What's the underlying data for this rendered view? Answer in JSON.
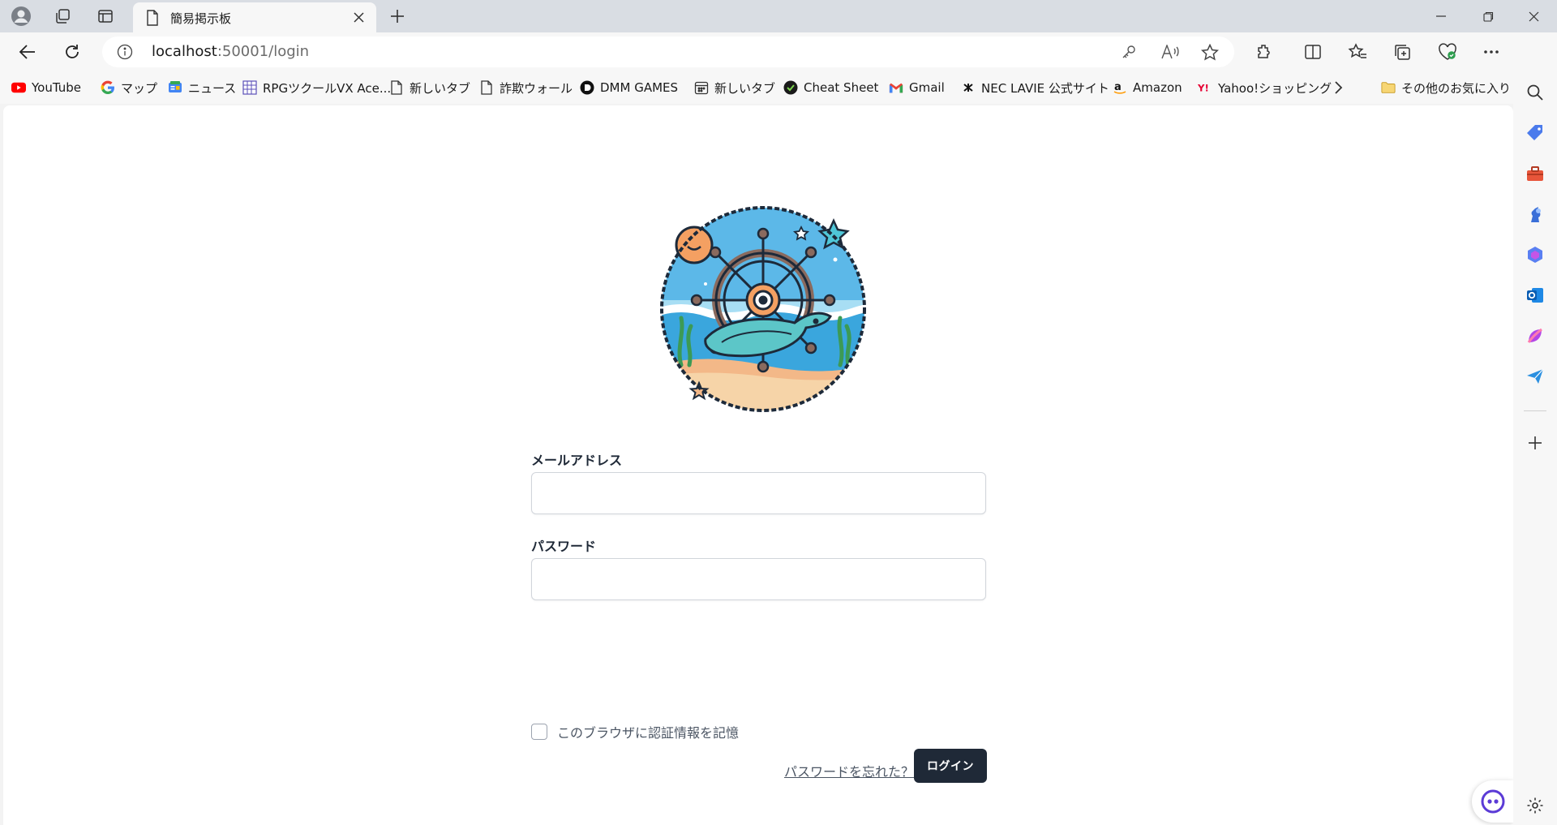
{
  "browser": {
    "tab": {
      "title": "簡易掲示板"
    },
    "address": {
      "host": "localhost",
      "path": ":50001/login"
    }
  },
  "bookmarks": [
    {
      "label": "YouTube",
      "icon": "youtube-icon"
    },
    {
      "label": "マップ",
      "icon": "google-icon"
    },
    {
      "label": "ニュース",
      "icon": "news-icon"
    },
    {
      "label": "RPGツクールVX Ace...",
      "icon": "rpg-icon"
    },
    {
      "label": "新しいタブ",
      "icon": "page-icon"
    },
    {
      "label": "詐欺ウォール",
      "icon": "page-icon"
    },
    {
      "label": "DMM GAMES",
      "icon": "dmm-icon"
    },
    {
      "label": "新しいタブ",
      "icon": "calendar-icon"
    },
    {
      "label": "Cheat Sheet",
      "icon": "cheatsheet-icon"
    },
    {
      "label": "Gmail",
      "icon": "gmail-icon"
    },
    {
      "label": "NEC LAVIE 公式サイト",
      "icon": "nec-icon"
    },
    {
      "label": "Amazon",
      "icon": "amazon-icon"
    },
    {
      "label": "Yahoo!ショッピング",
      "icon": "yahoo-icon"
    }
  ],
  "bookmarks_other": "その他のお気に入り",
  "login": {
    "email_label": "メールアドレス",
    "email_value": "",
    "password_label": "パスワード",
    "password_value": "",
    "remember_label": "このブラウザに認証情報を記憶",
    "remember_checked": false,
    "forgot_link": "パスワードを忘れた？",
    "submit_label": "ログイン"
  },
  "colors": {
    "button_bg": "#1f2937",
    "chrome_bg": "#d9dde3",
    "page_bg": "#ffffff"
  }
}
